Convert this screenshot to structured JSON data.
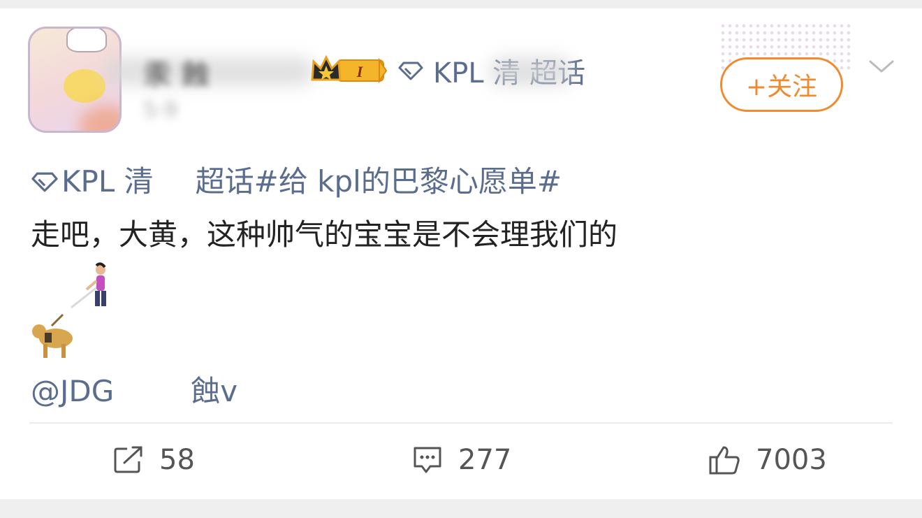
{
  "post": {
    "author": {
      "name_visible": "汞 蝕",
      "level_badge": "I",
      "supertopic_label": "KPL 清 超话",
      "sub_time": "5-9"
    },
    "follow_label": "+关注",
    "topic_line": {
      "supertopic": "KPL 清",
      "supertopic_suffix": "超话",
      "hashtag": "#给 kpl的巴黎心愿单#"
    },
    "text": "走吧，大黄，这种帅气的宝宝是不会理我们的",
    "emoji_1": "person-with-white-cane",
    "emoji_2": "guide-dog",
    "mention_prefix": "@JDG",
    "mention_suffix": "蝕v",
    "actions": {
      "repost_count": "58",
      "comment_count": "277",
      "like_count": "7003"
    }
  },
  "colors": {
    "link": "#5b6d8e",
    "follow_accent": "#f08a2d",
    "text": "#222222",
    "page_bg": "#efefef"
  }
}
